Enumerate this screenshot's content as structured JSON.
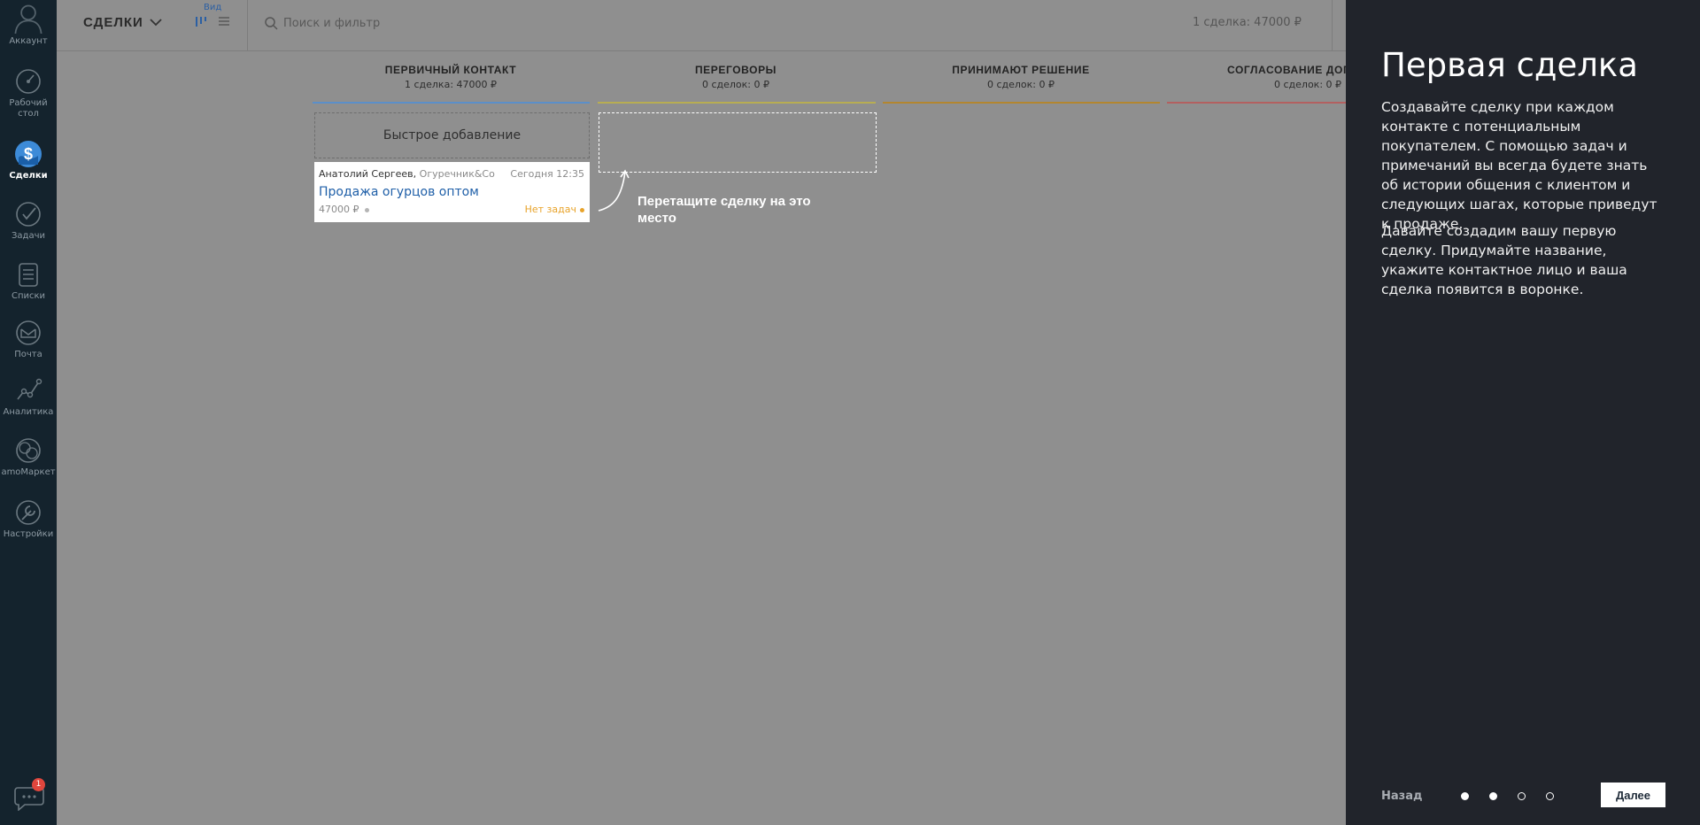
{
  "sidebar": {
    "items": [
      {
        "label": "Аккаунт",
        "icon": "account-icon"
      },
      {
        "label": "Рабочий стол",
        "icon": "dashboard-icon"
      },
      {
        "label": "Сделки",
        "icon": "deals-icon",
        "active": true
      },
      {
        "label": "Задачи",
        "icon": "tasks-icon"
      },
      {
        "label": "Списки",
        "icon": "lists-icon"
      },
      {
        "label": "Почта",
        "icon": "mail-icon"
      },
      {
        "label": "Аналитика",
        "icon": "analytics-icon"
      },
      {
        "label": "amoМаркет",
        "icon": "market-icon"
      },
      {
        "label": "Настройки",
        "icon": "settings-icon"
      }
    ],
    "chat_badge": "1"
  },
  "topbar": {
    "title": "СДЕЛКИ",
    "view_label": "Вид",
    "search_placeholder": "Поиск и фильтр",
    "summary": "1 сделка: 47000 ₽"
  },
  "pipeline": {
    "columns": [
      {
        "title": "ПЕРВИЧНЫЙ КОНТАКТ",
        "summary": "1 сделка: 47000 ₽",
        "color": "#5b8fc9"
      },
      {
        "title": "ПЕРЕГОВОРЫ",
        "summary": "0 сделок: 0 ₽",
        "color": "#b8ad52"
      },
      {
        "title": "ПРИНИМАЮТ РЕШЕНИЕ",
        "summary": "0 сделок: 0 ₽",
        "color": "#b3862f"
      },
      {
        "title": "СОГЛАСОВАНИЕ ДОГ",
        "summary": "0 сделок: 0 ₽",
        "color": "#b36060"
      }
    ],
    "quick_add": "Быстрое добавление",
    "deal": {
      "contact": "Анатолий Сергеев,",
      "company": "Огуречник&Co",
      "date": "Сегодня 12:35",
      "name": "Продажа огурцов оптом",
      "price": "47000 ₽",
      "tasks": "Нет задач"
    },
    "drag_hint": "Перетащите сделку на это место"
  },
  "onboarding": {
    "title": "Первая сделка",
    "paragraph1": "Создавайте сделку при каждом контакте с потенциальным покупателем. С помощью задач и примечаний вы всегда будете знать об истории общения с клиентом и следующих шагах, которые приведут к продаже.",
    "paragraph2": "Давайте создадим вашу первую сделку. Придумайте название, укажите контактное лицо и ваша сделка появится в воронке.",
    "back_label": "Назад",
    "next_label": "Далее",
    "steps_total": 4,
    "steps_done": 2
  },
  "colors": {
    "sidebar_bg": "#14232d",
    "panel_bg": "#21242b",
    "overlay_bg": "#8f8f8f",
    "link_blue": "#1f5fa8",
    "task_orange": "#e8a32a"
  }
}
